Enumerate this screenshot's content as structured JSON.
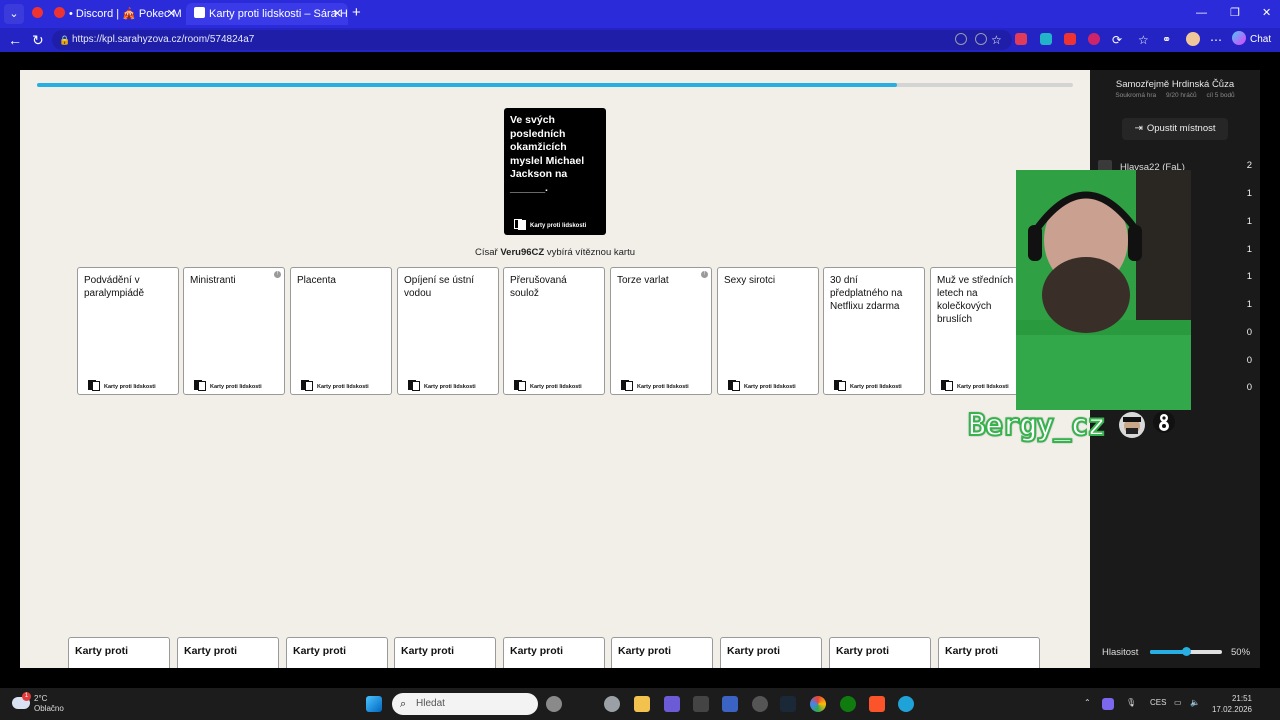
{
  "browser": {
    "tabs": [
      {
        "label": "",
        "active": false
      },
      {
        "label": "• Discord | 🎪 Pokec METKI 🔳",
        "active": false
      },
      {
        "label": "Karty proti lidskosti – Sára Hýžová",
        "active": true
      }
    ],
    "url": "https://kpl.sarahyzova.cz/room/574824a7",
    "chat_label": "Chat"
  },
  "game": {
    "progress_fraction": 0.83,
    "black_card": {
      "text": "Ve svých posledních okamžicích myslel Michael Jackson na ______.",
      "brand": "Karty proti lidskosti"
    },
    "czar": {
      "prefix": "Císař",
      "name": "Veru96CZ",
      "suffix": "vybírá vítěznou kartu"
    },
    "white_cards": [
      {
        "text": "Podvádění v paralympiádě",
        "flag": false
      },
      {
        "text": "Ministranti",
        "flag": true
      },
      {
        "text": "Placenta",
        "flag": false
      },
      {
        "text": "Opíjení se ústní vodou",
        "flag": false
      },
      {
        "text": "Přerušovaná soulož",
        "flag": false
      },
      {
        "text": "Torze varlat",
        "flag": true
      },
      {
        "text": "Sexy sirotci",
        "flag": false
      },
      {
        "text": "30 dní předplatného na Netflixu zdarma",
        "flag": false
      },
      {
        "text": "Muž ve středních letech na kolečkových bruslích",
        "flag": false
      }
    ],
    "card_brand": "Karty proti lidskosti",
    "hand_cards": [
      "Karty proti",
      "Karty proti",
      "Karty proti",
      "Karty proti",
      "Karty proti",
      "Karty proti",
      "Karty proti",
      "Karty proti",
      "Karty proti"
    ]
  },
  "sidebar": {
    "room_name": "Samozřejmě Hrdinská Čůza",
    "room_type": "Soukromá hra",
    "players_count": "9/20 hráčů",
    "goal": "cíl 5 bodů",
    "leave_label": "Opustit místnost",
    "players": [
      {
        "name": "Hlavsa22 (FaL)",
        "score": "2"
      },
      {
        "name": "",
        "score": "1"
      },
      {
        "name": "",
        "score": "1"
      },
      {
        "name": "",
        "score": "1"
      },
      {
        "name": "",
        "score": "1"
      },
      {
        "name": "",
        "score": "1"
      },
      {
        "name": "",
        "score": "0"
      },
      {
        "name": "",
        "score": "0"
      },
      {
        "name": "",
        "score": "0"
      }
    ],
    "volume_label": "Hlasitost",
    "volume_fraction": 0.5,
    "volume_text": "50%"
  },
  "overlay": {
    "streamer_name": "Bergy_cz"
  },
  "taskbar": {
    "temperature": "2°C",
    "weather": "Oblačno",
    "notif_count": "1",
    "search_placeholder": "Hledat",
    "lang": "CES",
    "time": "21:51",
    "date": "17.02.2026"
  },
  "colors": {
    "accent": "#27aee3",
    "tabbar": "#2b2bd9",
    "game_bg": "#f1efe8"
  }
}
